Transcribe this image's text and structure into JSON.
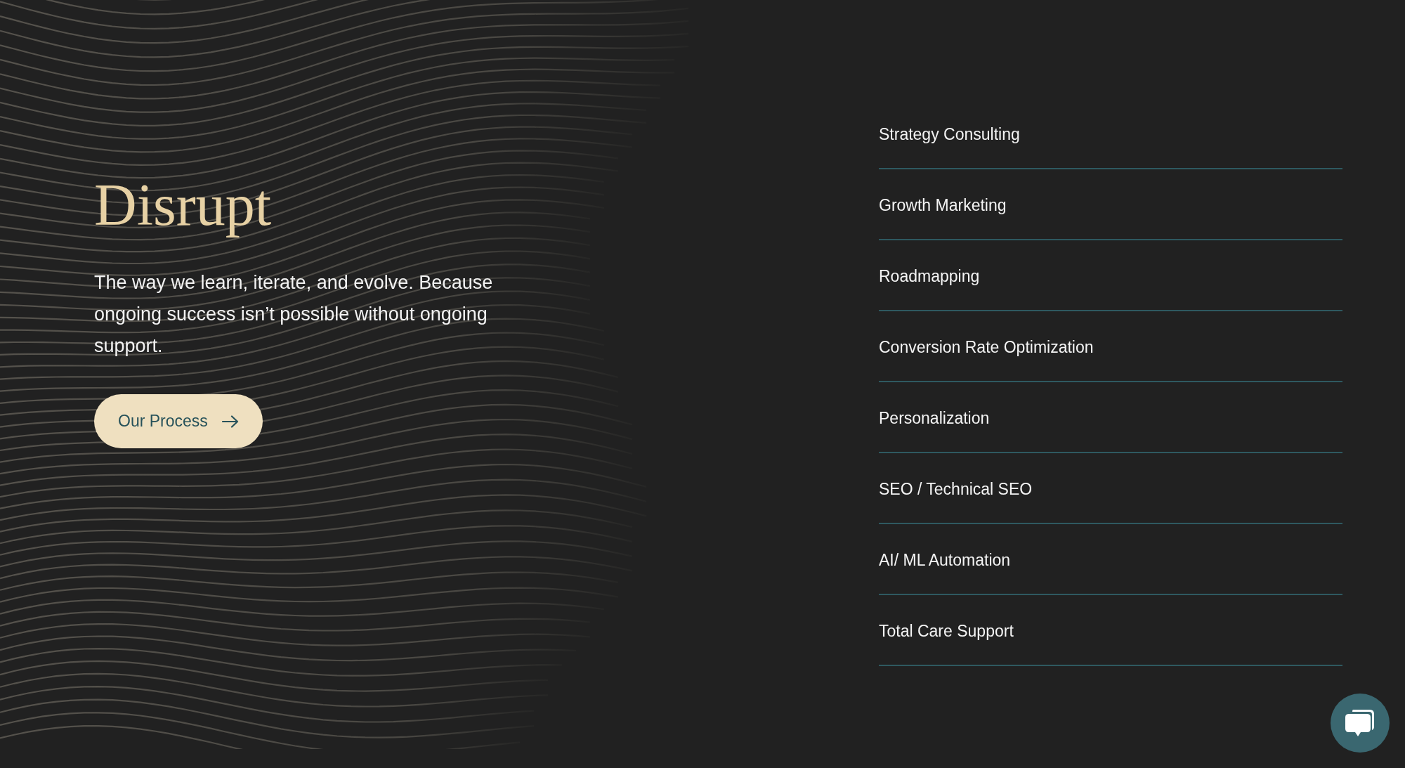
{
  "hero": {
    "title": "Disrupt",
    "description": "The way we learn, iterate, and evolve. Because ongoing success isn’t possible without ongoing support.",
    "button": {
      "label": "Our Process"
    }
  },
  "services": [
    {
      "label": "Strategy Consulting"
    },
    {
      "label": "Growth Marketing"
    },
    {
      "label": "Roadmapping"
    },
    {
      "label": "Conversion Rate Optimization"
    },
    {
      "label": "Personalization"
    },
    {
      "label": "SEO / Technical SEO"
    },
    {
      "label": "AI/ ML Automation"
    },
    {
      "label": "Total Care Support"
    }
  ]
}
